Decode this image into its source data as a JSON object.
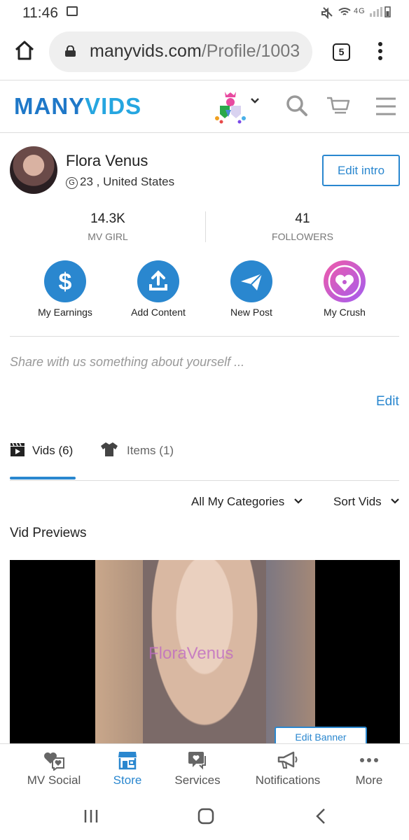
{
  "status_bar": {
    "time": "11:46",
    "network": "4G"
  },
  "browser": {
    "url_domain": "manyvids.com",
    "url_path": "/Profile/1003",
    "tab_count": "5"
  },
  "header": {
    "logo_part1": "MANY",
    "logo_part2": "VIDS"
  },
  "profile": {
    "name": "Flora Venus",
    "location": "23 , United States",
    "gender_icon": "G",
    "edit_intro_label": "Edit intro",
    "stats": [
      {
        "value": "14.3K",
        "label": "MV GIRL"
      },
      {
        "value": "41",
        "label": "FOLLOWERS"
      }
    ],
    "actions": [
      {
        "label": "My Earnings",
        "icon": "dollar-icon"
      },
      {
        "label": "Add Content",
        "icon": "upload-icon"
      },
      {
        "label": "New Post",
        "icon": "paper-plane-icon"
      },
      {
        "label": "My Crush",
        "icon": "heart-lock-icon"
      }
    ],
    "about_placeholder": "Share with us something about yourself ...",
    "edit_label": "Edit"
  },
  "content_tabs": [
    {
      "label": "Vids (6)",
      "active": true
    },
    {
      "label": "Items (1)",
      "active": false
    }
  ],
  "filters": {
    "categories": "All My Categories",
    "sort": "Sort Vids"
  },
  "section_title": "Vid Previews",
  "preview": {
    "watermark": "FloraVenus",
    "edit_banner_label": "Edit Banner"
  },
  "bottom_nav": [
    {
      "label": "MV Social",
      "active": false
    },
    {
      "label": "Store",
      "active": true
    },
    {
      "label": "Services",
      "active": false
    },
    {
      "label": "Notifications",
      "active": false
    },
    {
      "label": "More",
      "active": false
    }
  ],
  "colors": {
    "accent": "#2a87cf",
    "logo_dark": "#1f78c8",
    "logo_light": "#26a6e0"
  }
}
